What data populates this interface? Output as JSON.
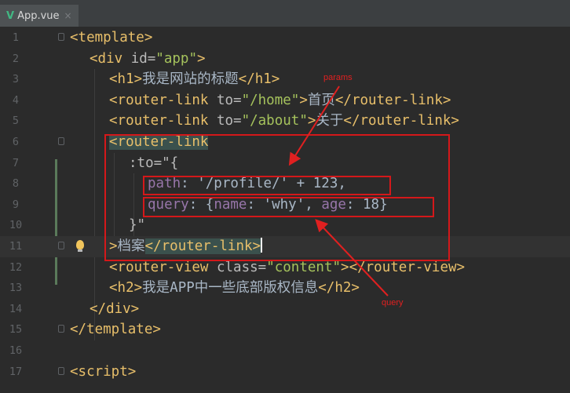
{
  "tab": {
    "icon": "vue-logo-icon",
    "label": "App.vue",
    "close": "×"
  },
  "lines": [
    {
      "n": "1"
    },
    {
      "n": "2"
    },
    {
      "n": "3"
    },
    {
      "n": "4"
    },
    {
      "n": "5"
    },
    {
      "n": "6"
    },
    {
      "n": "7"
    },
    {
      "n": "8"
    },
    {
      "n": "9"
    },
    {
      "n": "10"
    },
    {
      "n": "11"
    },
    {
      "n": "12"
    },
    {
      "n": "13"
    },
    {
      "n": "14"
    },
    {
      "n": "15"
    },
    {
      "n": "16"
    },
    {
      "n": "17"
    }
  ],
  "code": {
    "l1": {
      "tag": "<template>"
    },
    "l2": {
      "open": "<div ",
      "attr": "id=",
      "val": "\"app\"",
      "close": ">"
    },
    "l3": {
      "open": "<h1>",
      "text": "我是网站的标题",
      "close": "</h1>"
    },
    "l4": {
      "open": "<router-link ",
      "attr": "to=",
      "val": "\"/home\"",
      "gt": ">",
      "text": "首页",
      "close": "</router-link>"
    },
    "l5": {
      "open": "<router-link ",
      "attr": "to=",
      "val": "\"/about\"",
      "gt": ">",
      "text": "关于",
      "close": "</router-link>"
    },
    "l6": {
      "tag": "<router-link"
    },
    "l7": {
      "text": ":to=\"{"
    },
    "l8": {
      "prop": "path",
      "colon": ": ",
      "str": "'/profile/'",
      "op": " + ",
      "num": "123",
      "comma": ","
    },
    "l9": {
      "brace": "{",
      "p1": "name",
      "c1": ": ",
      "s1": "'why'",
      "sep": ", ",
      "p2": "age",
      "c2": ": ",
      "n2": "18",
      "end": "}"
    },
    "l10": {
      "text": "}\""
    },
    "l11": {
      "gt": ">",
      "text": "档案",
      "close": "</router-link>"
    },
    "l12": {
      "open": "<router-view ",
      "attr": "class=",
      "val": "\"content\"",
      "gt": ">",
      "close": "</router-view>"
    },
    "l13": {
      "open": "<h2>",
      "text": "我是APP中一些底部版权信息",
      "close": "</h2>"
    },
    "l14": {
      "tag": "</div>"
    },
    "l15": {
      "tag": "</template>"
    },
    "l17": {
      "tag": "<script>"
    }
  },
  "annotations": {
    "params": "params",
    "query": "query"
  },
  "colors": {
    "background": "#2b2b2b",
    "tag": "#e8bf6a",
    "string": "#a5c25c",
    "property": "#9876aa",
    "number": "#6897bb",
    "annotation": "#d4181a"
  }
}
